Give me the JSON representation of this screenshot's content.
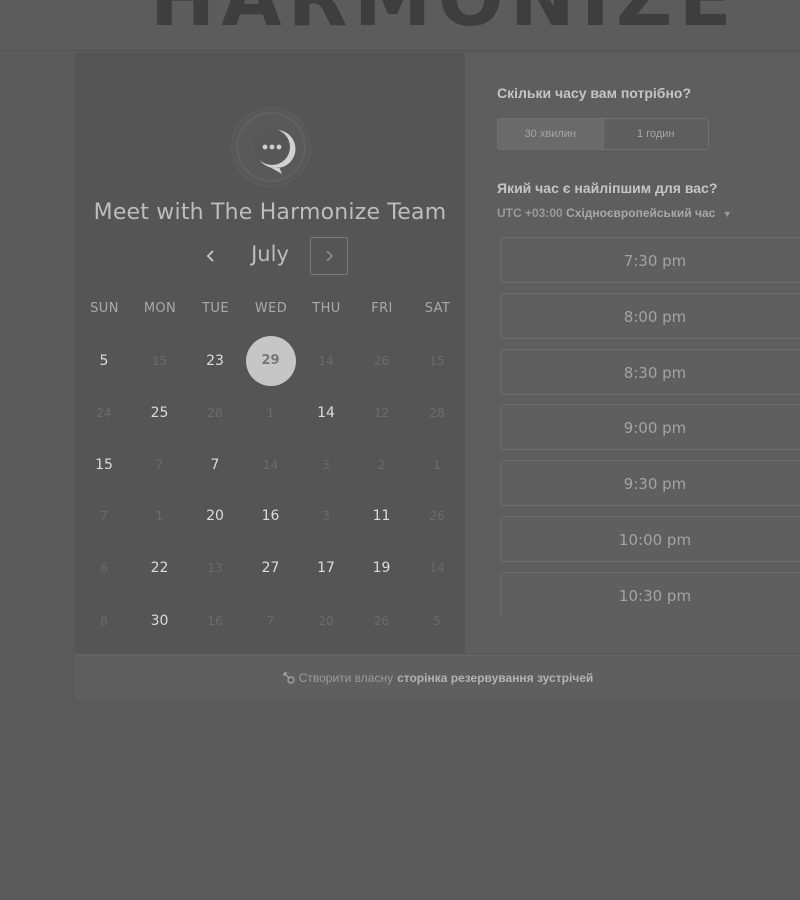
{
  "header": {
    "logo_text": "HARMONIZE"
  },
  "meeting": {
    "title": "Meet with The Harmonize Team"
  },
  "calendar": {
    "month": "July",
    "weekdays": [
      "SUN",
      "MON",
      "TUE",
      "WED",
      "THU",
      "FRI",
      "SAT"
    ],
    "weeks": [
      [
        {
          "d": "5",
          "s": "avail"
        },
        {
          "d": "15",
          "s": "dim"
        },
        {
          "d": "23",
          "s": "avail"
        },
        {
          "d": "29",
          "s": "selected"
        },
        {
          "d": "14",
          "s": "dim"
        },
        {
          "d": "26",
          "s": "dim"
        },
        {
          "d": "15",
          "s": "dim"
        }
      ],
      [
        {
          "d": "24",
          "s": "dim"
        },
        {
          "d": "25",
          "s": "avail"
        },
        {
          "d": "28",
          "s": "dim"
        },
        {
          "d": "1",
          "s": "dim"
        },
        {
          "d": "14",
          "s": "avail"
        },
        {
          "d": "12",
          "s": "dim"
        },
        {
          "d": "28",
          "s": "dim"
        }
      ],
      [
        {
          "d": "15",
          "s": "avail"
        },
        {
          "d": "7",
          "s": "dim"
        },
        {
          "d": "7",
          "s": "avail"
        },
        {
          "d": "14",
          "s": "dim"
        },
        {
          "d": "3",
          "s": "dim"
        },
        {
          "d": "2",
          "s": "dim"
        },
        {
          "d": "1",
          "s": "dim"
        }
      ],
      [
        {
          "d": "7",
          "s": "dim"
        },
        {
          "d": "1",
          "s": "dim"
        },
        {
          "d": "20",
          "s": "avail"
        },
        {
          "d": "16",
          "s": "avail"
        },
        {
          "d": "3",
          "s": "dim"
        },
        {
          "d": "11",
          "s": "avail"
        },
        {
          "d": "26",
          "s": "dim"
        }
      ],
      [
        {
          "d": "6",
          "s": "dim"
        },
        {
          "d": "22",
          "s": "avail"
        },
        {
          "d": "13",
          "s": "dim"
        },
        {
          "d": "27",
          "s": "avail"
        },
        {
          "d": "17",
          "s": "avail"
        },
        {
          "d": "19",
          "s": "avail"
        },
        {
          "d": "14",
          "s": "dim"
        }
      ],
      [
        {
          "d": "8",
          "s": "dim"
        },
        {
          "d": "30",
          "s": "avail"
        },
        {
          "d": "16",
          "s": "dim"
        },
        {
          "d": "7",
          "s": "dim"
        },
        {
          "d": "20",
          "s": "dim"
        },
        {
          "d": "26",
          "s": "dim"
        },
        {
          "d": "5",
          "s": "dim"
        }
      ]
    ]
  },
  "booking": {
    "duration_question": "Скільки часу вам потрібно?",
    "durations": [
      {
        "label": "30 хвилин",
        "active": true
      },
      {
        "label": "1 годин",
        "active": false
      }
    ],
    "time_question": "Який час є найліпшим для вас?",
    "timezone_offset": "UTC +03:00",
    "timezone_name": "Східноєвропейський час",
    "slots": [
      "7:30 pm",
      "8:00 pm",
      "8:30 pm",
      "9:00 pm",
      "9:30 pm",
      "10:00 pm",
      "10:30 pm"
    ]
  },
  "footer": {
    "prefix": "Створити власну",
    "link": "сторінка резервування зустрічей"
  },
  "colors": {
    "selected_day_bg": "#c6c6c6",
    "overlay": "#5a5a5a"
  }
}
